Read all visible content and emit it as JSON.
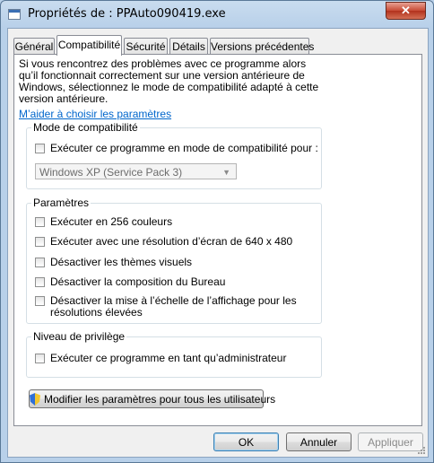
{
  "window": {
    "title": "Propriétés de : PPAuto090419.exe",
    "close_glyph": "✕"
  },
  "tabs": [
    {
      "label": "Général"
    },
    {
      "label": "Compatibilité"
    },
    {
      "label": "Sécurité"
    },
    {
      "label": "Détails"
    },
    {
      "label": "Versions précédentes"
    }
  ],
  "panel": {
    "intro_text": "Si vous rencontrez des problèmes avec ce programme alors qu’il fonctionnait correctement sur une version antérieure de Windows, sélectionnez le mode de compatibilité adapté à cette version antérieure.",
    "help_link": "M’aider à choisir les paramètres",
    "compat_group": {
      "title": "Mode de compatibilité",
      "checkbox_label": "Exécuter ce programme en mode de compatibilité pour :",
      "checked": false,
      "select_value": "Windows XP (Service Pack 3)"
    },
    "settings_group": {
      "title": "Paramètres",
      "items": [
        {
          "label": "Exécuter en 256 couleurs",
          "checked": false
        },
        {
          "label": "Exécuter avec une résolution d’écran de 640 x 480",
          "checked": false
        },
        {
          "label": "Désactiver les thèmes visuels",
          "checked": false
        },
        {
          "label": "Désactiver la composition du Bureau",
          "checked": false
        },
        {
          "label_line1": "Désactiver la mise à l’échelle de l’affichage pour les",
          "label_line2": "résolutions élevées",
          "checked": false
        }
      ]
    },
    "privilege_group": {
      "title": "Niveau de privilège",
      "checkbox_label": "Exécuter ce programme en tant qu’administrateur",
      "checked": false
    },
    "all_users_button": "Modifier les paramètres pour tous les utilisateurs"
  },
  "footer": {
    "ok": "OK",
    "cancel": "Annuler",
    "apply": "Appliquer"
  },
  "colors": {
    "link": "#0066cc",
    "close_button": "#c74a34",
    "window_frame": "#b8d0e9"
  }
}
